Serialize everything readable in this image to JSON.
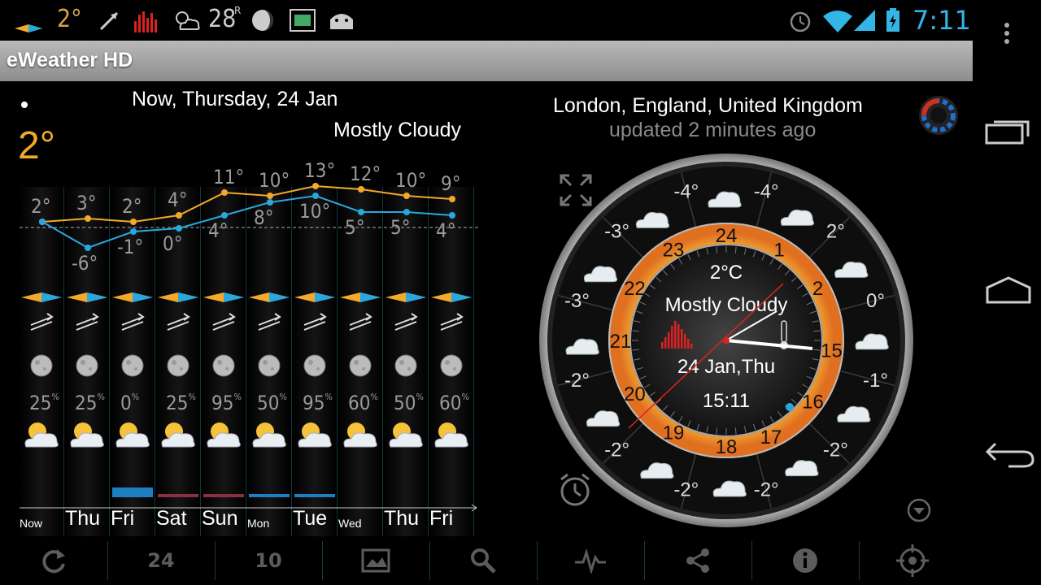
{
  "status_bar": {
    "temp_small": "2°",
    "temp_feel": "28",
    "temp_feel_unit": "R",
    "clock": "7:11"
  },
  "app": {
    "title": "eWeather HD"
  },
  "header": {
    "date_line": "Now, Thursday, 24 Jan",
    "condition": "Mostly Cloudy",
    "current_temp": "2°",
    "location": "London, England, United Kingdom",
    "updated": "updated 2 minutes ago"
  },
  "forecast": {
    "high_labels": [
      "2°",
      "3°",
      "2°",
      "4°",
      "11°",
      "10°",
      "13°",
      "12°",
      "10°",
      "9°"
    ],
    "low_labels": [
      "",
      "-6°",
      "-1°",
      "0°",
      "4°",
      "8°",
      "10°",
      "5°",
      "5°",
      "4°"
    ],
    "precip": [
      "25",
      "25",
      "0",
      "25",
      "95",
      "50",
      "95",
      "60",
      "50",
      "60"
    ],
    "precip_unit": "%",
    "days": [
      {
        "label": "Now",
        "small": true
      },
      {
        "label": "Thu",
        "small": false
      },
      {
        "label": "Fri",
        "small": false
      },
      {
        "label": "Sat",
        "small": false
      },
      {
        "label": "Sun",
        "small": false
      },
      {
        "label": "Mon",
        "small": true
      },
      {
        "label": "Tue",
        "small": false
      },
      {
        "label": "Wed",
        "small": true
      },
      {
        "label": "Thu",
        "small": false
      },
      {
        "label": "Fri",
        "small": false
      }
    ]
  },
  "chart_data": {
    "type": "line",
    "categories": [
      "Now",
      "Thu",
      "Fri",
      "Sat",
      "Sun",
      "Mon",
      "Tue",
      "Wed",
      "Thu",
      "Fri"
    ],
    "series": [
      {
        "values": [
          2,
          3,
          2,
          4,
          11,
          10,
          13,
          12,
          10,
          9
        ]
      },
      {
        "values": [
          2,
          -6,
          -1,
          0,
          4,
          8,
          10,
          5,
          5,
          4
        ]
      }
    ],
    "precip_percent": [
      25,
      25,
      0,
      25,
      95,
      50,
      95,
      60,
      50,
      60
    ],
    "colors": {
      "high": "#f3a92a",
      "low": "#29a8e0"
    }
  },
  "dial": {
    "temp": "2°C",
    "condition": "Mostly Cloudy",
    "date": "24 Jan,Thu",
    "time": "15:11",
    "hours": [
      "24",
      "1",
      "2",
      "15",
      "16",
      "17",
      "18",
      "19",
      "20",
      "21",
      "22",
      "23"
    ],
    "outer_temps": [
      "-3°",
      "-3°",
      "-4°",
      "-4°",
      "2°",
      "0°",
      "-1°",
      "-2°",
      "-2°",
      "-2°",
      "-2°",
      "-2°"
    ]
  },
  "toolbar": {
    "btn_24": "24",
    "btn_10": "10"
  }
}
